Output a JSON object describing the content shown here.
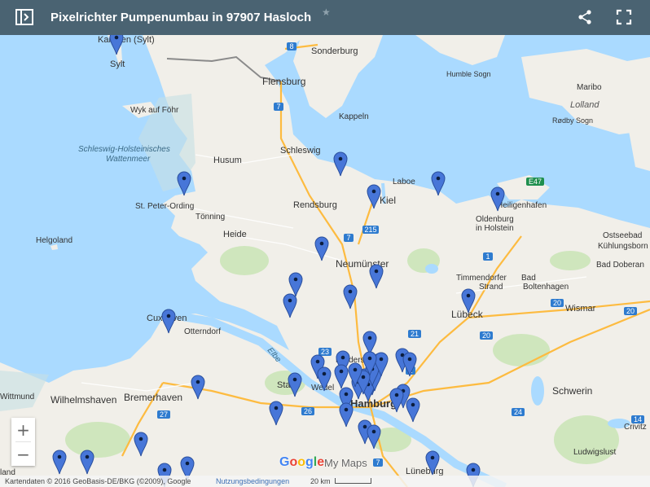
{
  "header": {
    "title": "Pixelrichter Pumpenumbau in 97907 Hasloch",
    "star_icon": "star-icon",
    "panel_icon": "side-panel-icon",
    "share_icon": "share-icon",
    "fullscreen_icon": "fullscreen-icon"
  },
  "zoom": {
    "in_label": "+",
    "out_label": "−"
  },
  "branding": {
    "google": "Google",
    "my_maps": "My Maps"
  },
  "footer": {
    "attribution": "Kartendaten © 2016 GeoBasis-DE/BKG (©2009), Google",
    "terms": "Nutzungsbedingungen",
    "scale": "20 km"
  },
  "colors": {
    "header": "#4a6372",
    "water": "#aadaff",
    "land": "#f1efe9",
    "marker": "#4776d8",
    "highway": "#fdbb40"
  },
  "places": [
    "Sylt",
    "Kampen (Sylt)",
    "Sonderburg",
    "Flensburg",
    "Humble Sogn",
    "Maribo",
    "Lolland",
    "Rødby Sogn",
    "Wyk auf Föhr",
    "Kappeln",
    "Schleswig",
    "Husum",
    "Schleswig-Holsteinisches",
    "Wattenmeer",
    "St. Peter-Ording",
    "Tönning",
    "Rendsburg",
    "Kiel",
    "Laboe",
    "Heiligenhafen",
    "Oldenburg",
    "in Holstein",
    "Ostseebad",
    "Kühlungsborn",
    "Helgoland",
    "Heide",
    "Neumünster",
    "Bad Doberan",
    "Timmendorfer",
    "Strand",
    "Bad",
    "Boltenhagen",
    "Cuxhaven",
    "Otterndorf",
    "Lübeck",
    "Wismar",
    "Elbe",
    "Norderstedt",
    "Stade",
    "Wedel",
    "Hamburg",
    "Schwerin",
    "Wilhelmshaven",
    "Bremerhaven",
    "Lüneburg",
    "Ludwigslust",
    "Crivitz",
    "Wittmund",
    "land"
  ],
  "road_shields": [
    "8",
    "7",
    "7",
    "215",
    "23",
    "21",
    "20",
    "26",
    "27",
    "1",
    "1",
    "20",
    "24",
    "14",
    "7",
    "E47",
    "20"
  ],
  "markers": [
    "marker-1",
    "marker-2",
    "marker-3",
    "marker-4",
    "marker-5",
    "marker-6",
    "marker-7",
    "marker-8",
    "marker-9",
    "marker-10",
    "marker-11",
    "marker-12",
    "marker-13",
    "marker-14",
    "marker-15",
    "marker-16",
    "marker-17",
    "marker-18",
    "marker-19",
    "marker-20",
    "marker-21",
    "marker-22",
    "marker-23",
    "marker-24",
    "marker-25",
    "marker-26",
    "marker-27",
    "marker-28",
    "marker-29",
    "marker-30",
    "marker-31",
    "marker-32",
    "marker-33",
    "marker-34",
    "marker-35",
    "marker-36",
    "marker-37",
    "marker-38",
    "marker-39",
    "marker-40",
    "marker-41",
    "marker-42",
    "marker-43",
    "marker-44",
    "marker-45",
    "marker-46",
    "marker-47",
    "marker-48"
  ]
}
